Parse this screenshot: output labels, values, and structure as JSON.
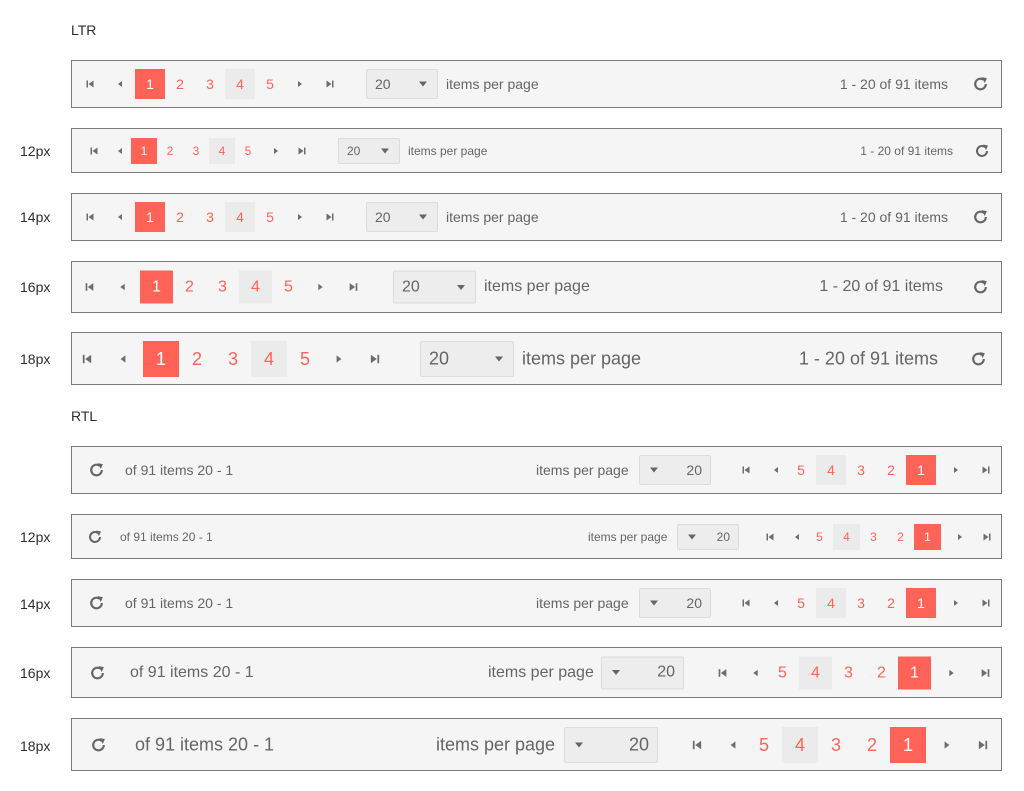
{
  "sections": {
    "ltr": "LTR",
    "rtl": "RTL"
  },
  "size_labels": [
    "12px",
    "14px",
    "16px",
    "18px"
  ],
  "pager": {
    "pages": [
      "1",
      "2",
      "3",
      "4",
      "5"
    ],
    "selected_page": "1",
    "hovered_page": "4",
    "page_size": "20",
    "items_per_page_label": "items per page",
    "info_ltr": "1 - 20 of 91 items",
    "info_rtl": "of 91 items 20 - 1",
    "icons": [
      "first-page-icon",
      "previous-page-icon",
      "next-page-icon",
      "last-page-icon",
      "chevron-down-icon",
      "refresh-icon"
    ]
  },
  "colors": {
    "accent": "#ff6358",
    "hover": "#ebebeb",
    "pager_bg": "#f5f5f5",
    "border": "#7a7a7a"
  }
}
